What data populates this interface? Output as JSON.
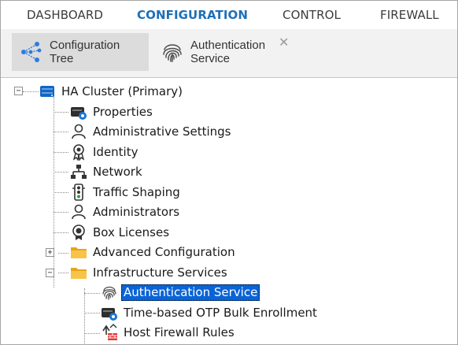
{
  "topnav": {
    "items": [
      {
        "label": "DASHBOARD"
      },
      {
        "label": "CONFIGURATION",
        "active": true
      },
      {
        "label": "CONTROL"
      },
      {
        "label": "FIREWALL"
      }
    ]
  },
  "tabs": [
    {
      "line1": "Configuration",
      "line2": "Tree",
      "icon": "tree-share-icon",
      "selected": true
    },
    {
      "line1": "Authentication",
      "line2": "Service",
      "icon": "fingerprint-icon",
      "close": "✕"
    }
  ],
  "tree": {
    "root": {
      "label": "HA Cluster (Primary)",
      "expander": "−",
      "icon": "server-icon"
    },
    "items": [
      {
        "label": "Properties",
        "icon": "properties-icon"
      },
      {
        "label": "Administrative Settings",
        "icon": "user-icon"
      },
      {
        "label": "Identity",
        "icon": "certificate-icon"
      },
      {
        "label": "Network",
        "icon": "network-icon"
      },
      {
        "label": "Traffic Shaping",
        "icon": "traffic-light-icon"
      },
      {
        "label": "Administrators",
        "icon": "user-icon"
      },
      {
        "label": "Box Licenses",
        "icon": "license-icon"
      },
      {
        "label": "Advanced Configuration",
        "icon": "folder-icon",
        "expander": "+"
      },
      {
        "label": "Infrastructure Services",
        "icon": "folder-icon",
        "expander": "−"
      },
      {
        "label": "Authentication Service",
        "icon": "fingerprint-icon",
        "selected": true
      },
      {
        "label": "Time-based OTP Bulk Enrollment",
        "icon": "properties-icon"
      },
      {
        "label": "Host Firewall Rules",
        "icon": "firewall-rules-icon"
      }
    ]
  },
  "colors": {
    "accent": "#1d70b8",
    "selection": "#0a64d6",
    "folder": "#f2b42b",
    "tab_selected": "#dcdcdc"
  }
}
